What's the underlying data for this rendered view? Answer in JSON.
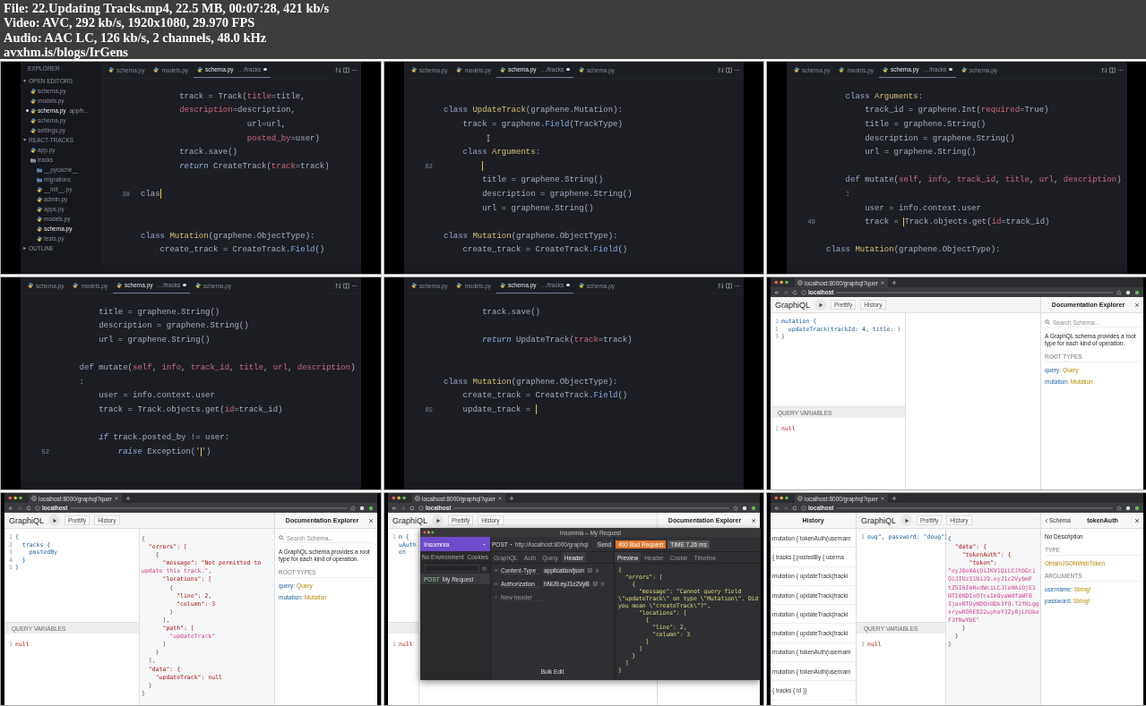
{
  "info": [
    "File: 22.Updating Tracks.mp4, 22.5 MB, 00:07:28, 421 kb/s",
    "Video: AVC, 292 kb/s, 1920x1080, 29.970 FPS",
    "Audio: AAC LC, 126 kb/s, 2 channels, 48.0 kHz",
    "avxhm.is/blogs/IrGens"
  ],
  "frames": [
    {
      "kind": "editor",
      "sidebar": {
        "title": "EXPLORER",
        "sections": [
          {
            "title": "OPEN EDITORS",
            "expanded": true,
            "items": [
              {
                "label": "schema.py",
                "kind": "file",
                "selected": false,
                "modified": false
              },
              {
                "label": "models.py",
                "kind": "file",
                "selected": false,
                "modified": false
              },
              {
                "label": "schema.py",
                "path": "app/tr...",
                "kind": "file",
                "selected": true,
                "modified": true
              },
              {
                "label": "schema.py",
                "kind": "file",
                "selected": false,
                "modified": false
              },
              {
                "label": "settings.py",
                "kind": "file",
                "selected": false,
                "modified": false
              }
            ]
          },
          {
            "title": "REACT-TRACKS",
            "expanded": true,
            "items": [
              {
                "label": "app.py",
                "kind": "file",
                "selected": false,
                "modified": false
              },
              {
                "label": "tracks",
                "kind": "folder",
                "expanded": true,
                "selected": false,
                "modified": false,
                "children": [
                  {
                    "label": "__pycache__",
                    "kind": "folder",
                    "expanded": false,
                    "selected": false,
                    "modified": false
                  },
                  {
                    "label": "migrations",
                    "kind": "folder",
                    "expanded": false,
                    "selected": false,
                    "modified": false
                  },
                  {
                    "label": "__init__.py",
                    "kind": "file",
                    "selected": false,
                    "modified": false
                  },
                  {
                    "label": "admin.py",
                    "kind": "file",
                    "selected": false,
                    "modified": false
                  },
                  {
                    "label": "apps.py",
                    "kind": "file",
                    "selected": false,
                    "modified": false
                  },
                  {
                    "label": "models.py",
                    "kind": "file",
                    "selected": false,
                    "modified": false
                  },
                  {
                    "label": "schema.py",
                    "kind": "file",
                    "selected": true,
                    "modified": false
                  },
                  {
                    "label": "tests.py",
                    "kind": "file",
                    "selected": false,
                    "modified": false
                  }
                ]
              }
            ]
          },
          {
            "title": "OUTLINE",
            "expanded": false
          }
        ]
      },
      "tabs": [
        {
          "label": "schema.py",
          "selected": false,
          "modified": false
        },
        {
          "label": "models.py",
          "selected": false,
          "modified": false
        },
        {
          "label": "schema.py",
          "path": "…/tracks",
          "selected": true,
          "modified": true
        }
      ],
      "lines": [
        {
          "tokens": [
            {
              "text": "        track = Track(",
              "kind": "txt"
            },
            {
              "text": "title",
              "kind": "arg"
            },
            {
              "text": "=title,",
              "kind": "txt"
            }
          ],
          "cursor": false
        },
        {
          "tokens": [
            {
              "text": "        description",
              "kind": "arg"
            },
            {
              "text": "=description,",
              "kind": "txt"
            }
          ],
          "cursor": false
        },
        {
          "tokens": [
            {
              "text": "                      url=url,",
              "kind": "txt"
            }
          ],
          "cursor": false
        },
        {
          "tokens": [
            {
              "text": "                      posted_by",
              "kind": "arg"
            },
            {
              "text": "=user)",
              "kind": "txt"
            }
          ],
          "cursor": false
        },
        {
          "tokens": [
            {
              "text": "        track.save()",
              "kind": "txt"
            }
          ],
          "cursor": false
        },
        {
          "tokens": [
            {
              "text": "        return",
              "kind": "ret"
            },
            {
              "text": " CreateTrack(",
              "kind": "txt"
            },
            {
              "text": "track",
              "kind": "arg"
            },
            {
              "text": "=track)",
              "kind": "txt"
            }
          ],
          "cursor": false
        },
        {
          "cursor": false
        },
        {
          "g": "38",
          "tokens": [
            {
              "text": "clas",
              "kind": "txt"
            }
          ],
          "cursor": true
        },
        {
          "cursor": false
        },
        {
          "cursor": false
        },
        {
          "tokens": [
            {
              "text": "class",
              "kind": "kw"
            },
            {
              "text": " Mutation",
              "kind": "name"
            },
            {
              "text": "(graphene.ObjectType):",
              "kind": "txt"
            }
          ],
          "cursor": false
        },
        {
          "tokens": [
            {
              "text": "    create_track = CreateTrack.",
              "kind": "txt"
            },
            {
              "text": "Field",
              "kind": "fn"
            },
            {
              "text": "()",
              "kind": "txt"
            }
          ],
          "cursor": false
        }
      ]
    },
    {
      "kind": "editor",
      "tabs": [
        {
          "label": "schema.py",
          "selected": false,
          "modified": false
        },
        {
          "label": "models.py",
          "selected": false,
          "modified": false
        },
        {
          "label": "schema.py",
          "path": "…/tracks",
          "selected": true,
          "modified": true
        },
        {
          "label": "schema.py",
          "selected": false,
          "modified": false
        }
      ],
      "lines": [
        {
          "cursor": false
        },
        {
          "tokens": [
            {
              "text": "class",
              "kind": "kw"
            },
            {
              "text": " UpdateTrack",
              "kind": "name"
            },
            {
              "text": "(graphene.Mutation):",
              "kind": "txt"
            }
          ],
          "cursor": false
        },
        {
          "tokens": [
            {
              "text": "    track = graphene.",
              "kind": "txt"
            },
            {
              "text": "Field",
              "kind": "fn"
            },
            {
              "text": "(TrackType)",
              "kind": "txt"
            }
          ],
          "cursor": false
        },
        {
          "pointer": true,
          "cursor": false
        },
        {
          "tokens": [
            {
              "text": "    class",
              "kind": "kw"
            },
            {
              "text": " Arguments",
              "kind": "name"
            },
            {
              "text": ":",
              "kind": "txt"
            }
          ],
          "cursor": false
        },
        {
          "g": "62",
          "cursor": true
        },
        {
          "tokens": [
            {
              "text": "        title = graphene.String()",
              "kind": "txt"
            }
          ],
          "cursor": false
        },
        {
          "tokens": [
            {
              "text": "        description = graphene.String()",
              "kind": "txt"
            }
          ],
          "cursor": false
        },
        {
          "tokens": [
            {
              "text": "        url = graphene.String()",
              "kind": "txt"
            }
          ],
          "cursor": false
        },
        {
          "cursor": false
        },
        {
          "tokens": [
            {
              "text": "class",
              "kind": "kw"
            },
            {
              "text": " Mutation",
              "kind": "name"
            },
            {
              "text": "(graphene.ObjectType):",
              "kind": "txt"
            }
          ],
          "cursor": false
        },
        {
          "tokens": [
            {
              "text": "    create_track = CreateTrack.",
              "kind": "txt"
            },
            {
              "text": "Field",
              "kind": "fn"
            },
            {
              "text": "()",
              "kind": "txt"
            }
          ],
          "cursor": false
        }
      ]
    },
    {
      "kind": "editor",
      "tabs": [
        {
          "label": "schema.py",
          "selected": false,
          "modified": false
        },
        {
          "label": "models.py",
          "selected": false,
          "modified": false
        },
        {
          "label": "schema.py",
          "path": "…/tracks",
          "selected": true,
          "modified": true
        },
        {
          "label": "schema.py",
          "selected": false,
          "modified": false
        }
      ],
      "lines": [
        {
          "tokens": [
            {
              "text": "    class",
              "kind": "kw"
            },
            {
              "text": " Arguments",
              "kind": "name"
            },
            {
              "text": ":",
              "kind": "txt"
            }
          ],
          "cursor": false
        },
        {
          "tokens": [
            {
              "text": "        track_id = graphene.Int(",
              "kind": "txt"
            },
            {
              "text": "required",
              "kind": "arg"
            },
            {
              "text": "=True)",
              "kind": "txt"
            }
          ],
          "cursor": false
        },
        {
          "tokens": [
            {
              "text": "        title = graphene.String()",
              "kind": "txt"
            }
          ],
          "cursor": false
        },
        {
          "tokens": [
            {
              "text": "        description = graphene.String()",
              "kind": "txt"
            }
          ],
          "cursor": false
        },
        {
          "tokens": [
            {
              "text": "        url = graphene.String()",
              "kind": "txt"
            }
          ],
          "cursor": false
        },
        {
          "cursor": false
        },
        {
          "tokens": [
            {
              "text": "    def",
              "kind": "kw"
            },
            {
              "text": " mutate(",
              "kind": "txt"
            },
            {
              "text": "self",
              "kind": "arg"
            },
            {
              "text": ", ",
              "kind": "txt"
            },
            {
              "text": "info",
              "kind": "arg"
            },
            {
              "text": ", ",
              "kind": "txt"
            },
            {
              "text": "track_id",
              "kind": "arg"
            },
            {
              "text": ", ",
              "kind": "txt"
            },
            {
              "text": "title",
              "kind": "arg"
            },
            {
              "text": ", ",
              "kind": "txt"
            },
            {
              "text": "url",
              "kind": "arg"
            },
            {
              "text": ", ",
              "kind": "txt"
            },
            {
              "text": "description",
              "kind": "arg"
            },
            {
              "text": ")",
              "kind": "txt"
            }
          ],
          "cursor": false
        },
        {
          "tokens": [
            {
              "text": "    :",
              "kind": "txt"
            }
          ],
          "cursor": false
        },
        {
          "tokens": [
            {
              "text": "        user = info.context.user",
              "kind": "txt"
            }
          ],
          "cursor": false
        },
        {
          "g": "49",
          "tokens": [
            {
              "text": "        track = ",
              "kind": "txt"
            }
          ],
          "cursor": true,
          "after": [
            {
              "text": "Track.objects.get(",
              "kind": "txt"
            },
            {
              "text": "id",
              "kind": "arg"
            },
            {
              "text": "=track_id)",
              "kind": "txt"
            }
          ]
        },
        {
          "cursor": false
        },
        {
          "tokens": [
            {
              "text": "class",
              "kind": "kw"
            },
            {
              "text": " Mutation",
              "kind": "name"
            },
            {
              "text": "(graphene.ObjectType):",
              "kind": "txt"
            }
          ],
          "cursor": false
        }
      ]
    },
    {
      "kind": "editor",
      "tabs": [
        {
          "label": "schema.py",
          "selected": false,
          "modified": false
        },
        {
          "label": "models.py",
          "selected": false,
          "modified": false
        },
        {
          "label": "schema.py",
          "path": "…/tracks",
          "selected": true,
          "modified": true
        },
        {
          "label": "schema.py",
          "selected": false,
          "modified": false
        }
      ],
      "lines": [
        {
          "tokens": [
            {
              "text": "        title = graphene.String()",
              "kind": "txt"
            }
          ],
          "cursor": false
        },
        {
          "tokens": [
            {
              "text": "        description = graphene.String()",
              "kind": "txt"
            }
          ],
          "cursor": false
        },
        {
          "tokens": [
            {
              "text": "        url = graphene.String()",
              "kind": "txt"
            }
          ],
          "cursor": false
        },
        {
          "cursor": false
        },
        {
          "tokens": [
            {
              "text": "    def",
              "kind": "kw"
            },
            {
              "text": " mutate(",
              "kind": "txt"
            },
            {
              "text": "self",
              "kind": "arg"
            },
            {
              "text": ", ",
              "kind": "txt"
            },
            {
              "text": "info",
              "kind": "arg"
            },
            {
              "text": ", ",
              "kind": "txt"
            },
            {
              "text": "track_id",
              "kind": "arg"
            },
            {
              "text": ", ",
              "kind": "txt"
            },
            {
              "text": "title",
              "kind": "arg"
            },
            {
              "text": ", ",
              "kind": "txt"
            },
            {
              "text": "url",
              "kind": "arg"
            },
            {
              "text": ", ",
              "kind": "txt"
            },
            {
              "text": "description",
              "kind": "arg"
            },
            {
              "text": ")",
              "kind": "txt"
            }
          ],
          "cursor": false
        },
        {
          "tokens": [
            {
              "text": "    :",
              "kind": "txt"
            }
          ],
          "cursor": false
        },
        {
          "tokens": [
            {
              "text": "        user = info.context.user",
              "kind": "txt"
            }
          ],
          "cursor": false
        },
        {
          "tokens": [
            {
              "text": "        track = Track.objects.get(",
              "kind": "txt"
            },
            {
              "text": "id",
              "kind": "arg"
            },
            {
              "text": "=track_id)",
              "kind": "txt"
            }
          ],
          "cursor": false
        },
        {
          "cursor": false
        },
        {
          "tokens": [
            {
              "text": "        if",
              "kind": "ret"
            },
            {
              "text": " track.posted_by != user:",
              "kind": "txt"
            }
          ],
          "cursor": false
        },
        {
          "g": "52",
          "tokens": [
            {
              "text": "            raise",
              "kind": "ret"
            },
            {
              "text": " Exception('",
              "kind": "txt"
            }
          ],
          "cursor": true,
          "after": [
            {
              "text": "')",
              "kind": "txt"
            }
          ]
        }
      ]
    },
    {
      "kind": "editor",
      "tabs": [
        {
          "label": "schema.py",
          "selected": false,
          "modified": false
        },
        {
          "label": "models.py",
          "selected": false,
          "modified": false
        },
        {
          "label": "schema.py",
          "path": "…/tracks",
          "selected": true,
          "modified": true
        },
        {
          "label": "schema.py",
          "selected": false,
          "modified": false
        }
      ],
      "lines": [
        {
          "tokens": [
            {
              "text": "        track.save()",
              "kind": "txt"
            }
          ],
          "cursor": false
        },
        {
          "cursor": false
        },
        {
          "tokens": [
            {
              "text": "        return",
              "kind": "ret"
            },
            {
              "text": " UpdateTrack(",
              "kind": "txt"
            },
            {
              "text": "track",
              "kind": "arg"
            },
            {
              "text": "=track)",
              "kind": "txt"
            }
          ],
          "cursor": false
        },
        {
          "cursor": false
        },
        {
          "cursor": false
        },
        {
          "tokens": [
            {
              "text": "class",
              "kind": "kw"
            },
            {
              "text": " Mutation",
              "kind": "name"
            },
            {
              "text": "(graphene.ObjectType):",
              "kind": "txt"
            }
          ],
          "cursor": false
        },
        {
          "tokens": [
            {
              "text": "    create_track = CreateTrack.",
              "kind": "txt"
            },
            {
              "text": "Field",
              "kind": "fn"
            },
            {
              "text": "()",
              "kind": "txt"
            }
          ],
          "cursor": false
        },
        {
          "g": "65",
          "tokens": [
            {
              "text": "    update_track = ",
              "kind": "txt"
            }
          ],
          "cursor": true
        }
      ]
    },
    {
      "kind": "graphiql",
      "browser": {
        "tab": "localhost:8000/graphql?quer",
        "url": "localhost"
      },
      "toolbar": {
        "title": "GraphiQL",
        "buttons": [
          "Prettify",
          "History"
        ]
      },
      "query": [
        {
          "n": "1",
          "text": "mutation {"
        },
        {
          "n": "2",
          "text": "  updateTrack(trackId: 4, title: )"
        },
        {
          "n": "3",
          "text": "}"
        }
      ],
      "variables_title": "QUERY VARIABLES",
      "variables": [
        {
          "n": "1",
          "text": "null"
        }
      ],
      "docs": {
        "title": "Documentation Explorer",
        "search": {
          "placeholder": "Search Schema..."
        },
        "description": "A GraphQL schema provides a root type for each kind of operation.",
        "sections": [
          {
            "heading": "ROOT TYPES",
            "items": [
              {
                "name": "query:",
                "type": "Query"
              },
              {
                "name": "mutation:",
                "type": "Mutation"
              }
            ]
          }
        ]
      }
    },
    {
      "kind": "graphiql",
      "browser": {
        "tab": "localhost:8000/graphql?quer",
        "url": "localhost"
      },
      "toolbar": {
        "title": "GraphiQL",
        "buttons": [
          "Prettify",
          "History"
        ]
      },
      "query": [
        {
          "n": "1",
          "text": "{"
        },
        {
          "n": "2",
          "text": "  tracks {"
        },
        {
          "n": "3",
          "text": "    postedBy"
        },
        {
          "n": "4",
          "text": "  }"
        },
        {
          "n": "5",
          "text": "}"
        }
      ],
      "result": [
        {
          "text": "{",
          "kind": "p"
        },
        {
          "text": "  \"errors\": [",
          "kind": "key"
        },
        {
          "text": "    {",
          "kind": "p"
        },
        {
          "text": "      \"message\": \"Not permitted to",
          "kind": "key"
        },
        {
          "text": "update this track.\",",
          "kind": "str"
        },
        {
          "text": "      \"locations\": [",
          "kind": "key"
        },
        {
          "text": "        {",
          "kind": "p"
        },
        {
          "text": "          \"line\": 2,",
          "kind": "key"
        },
        {
          "text": "          \"column\": 3",
          "kind": "key"
        },
        {
          "text": "        }",
          "kind": "p"
        },
        {
          "text": "      ],",
          "kind": "p"
        },
        {
          "text": "      \"path\": [",
          "kind": "key"
        },
        {
          "text": "        \"updateTrack\"",
          "kind": "str"
        },
        {
          "text": "      ]",
          "kind": "p"
        },
        {
          "text": "    }",
          "kind": "p"
        },
        {
          "text": "  ],",
          "kind": "p"
        },
        {
          "text": "  \"data\": {",
          "kind": "key"
        },
        {
          "text": "    \"updateTrack\": null",
          "kind": "key"
        },
        {
          "text": "  }",
          "kind": "p"
        },
        {
          "text": "}",
          "kind": "p"
        }
      ],
      "variables_title": "QUERY VARIABLES",
      "variables": [
        {
          "n": "1",
          "text": "null"
        }
      ],
      "docs": {
        "title": "Documentation Explorer",
        "search": {
          "placeholder": "Search Schema..."
        },
        "description": "A GraphQL schema provides a root type for each kind of operation.",
        "sections": [
          {
            "heading": "ROOT TYPES",
            "items": [
              {
                "name": "query:",
                "type": "Query"
              },
              {
                "name": "mutation:",
                "type": "Mutation"
              }
            ]
          }
        ]
      }
    },
    {
      "kind": "graphiql",
      "browser": {
        "tab": "localhost:8000/graphql?quer",
        "url": "localhost"
      },
      "toolbar": {
        "title": "GraphiQL",
        "buttons": [
          "Prettify",
          "History"
        ]
      },
      "query": [
        {
          "n": "1",
          "text": "m {"
        },
        {
          "text": "uAuth"
        },
        {
          "text": "en"
        }
      ],
      "variables": [
        {
          "n": "1",
          "text": "null"
        }
      ],
      "docs": {
        "title": "Documentation Explorer"
      },
      "overlay": {
        "title": "Insomnia – My Request",
        "brand": "Insomnia",
        "environment": "No Environment",
        "cookies": "Cookies",
        "requests": [
          {
            "method": "POST",
            "name": "My Request",
            "selected": true
          }
        ],
        "method": "POST",
        "url": "http://localhost:8000/graphql",
        "send": "Send",
        "status": "400 Bad Request",
        "time": "TIME 7.26 ms",
        "request_tabs": [
          {
            "label": "GraphQL",
            "selected": false
          },
          {
            "label": "Auth",
            "selected": false
          },
          {
            "label": "Query",
            "selected": false
          },
          {
            "label": "Header",
            "selected": true
          }
        ],
        "headers": [
          {
            "name": "Content-Type",
            "value": "application/json",
            "enabled": true
          },
          {
            "name": "Authorization",
            "value": "hNiJ9.eyJ1c2VyB",
            "enabled": true
          }
        ],
        "new_header": {
          "placeholder": "New header"
        },
        "bulk_edit": "Bulk Edit",
        "response_tabs": [
          {
            "label": "Preview",
            "selected": true
          },
          {
            "label": "Header",
            "selected": false
          },
          {
            "label": "Cookie",
            "selected": false
          },
          {
            "label": "Timeline",
            "selected": false
          }
        ],
        "response": [
          "{",
          "  \"errors\": [",
          "    {",
          "      \"message\": \"Cannot query field",
          "\\\"updateTrack\\\" on type \\\"Mutation\\\". Did",
          "you mean \\\"createTrack\\\"?\",",
          "      \"locations\": [",
          "        {",
          "          \"line\": 2,",
          "          \"column\": 3",
          "        }",
          "      ]",
          "    }",
          "  ]",
          "}"
        ]
      }
    },
    {
      "kind": "graphiql",
      "browser": {
        "tab": "localhost:8000/graphql?quer",
        "url": "localhost"
      },
      "history": {
        "title": "History",
        "items": [
          "mutation { tokenAuth(usernam",
          "{ tracks { postedBy { userna",
          "mutation { updateTrack(tracki",
          "mutation { updateTrack(tracki",
          "mutation { updateTrack(tracki",
          "mutation { updateTrack(tracki",
          "mutation { tokenAuth(usernam",
          "mutation { tokenAuth(usernam",
          "{ tracks { id }}"
        ]
      },
      "toolbar": {
        "title": "GraphiQL",
        "buttons": [
          "Prettify",
          "History"
        ]
      },
      "query": [
        {
          "n": "1",
          "text": "oug\", password: \"doug\"}"
        }
      ],
      "result": [
        {
          "text": "{",
          "kind": "p"
        },
        {
          "text": "  \"data\": {",
          "kind": "key"
        },
        {
          "text": "    \"tokenAuth\": {",
          "kind": "key"
        },
        {
          "text": "      \"token\":",
          "kind": "key"
        },
        {
          "text": "\"eyJ0eXAiOiJKV1QiLCJhbGci",
          "kind": "str"
        },
        {
          "text": "OiJIUzI1NiJ9.eyJ1c2VybmF",
          "kind": "str"
        },
        {
          "text": "tZSI6ImRvdWciLCJleHAiOjE1",
          "kind": "str"
        },
        {
          "text": "NTI0NDIxOTcsIm9yaWdfaWF0",
          "kind": "str"
        },
        {
          "text": "IjoxNTUyNDQxODk3fQ.T2fKLgg",
          "kind": "str"
        },
        {
          "text": "xrywRORE822uyhoY3Zy8jLhUke",
          "kind": "str"
        },
        {
          "text": "F3fNwYbE\"",
          "kind": "str"
        },
        {
          "text": "    }",
          "kind": "p"
        },
        {
          "text": "  }",
          "kind": "p"
        },
        {
          "text": "}",
          "kind": "p"
        }
      ],
      "variables_title": "QUERY VARIABLES",
      "variables": [
        {
          "n": "1",
          "text": "null"
        }
      ],
      "docs": {
        "back": "Schema",
        "title": "tokenAuth",
        "description": "No Description",
        "sections": [
          {
            "heading": "TYPE",
            "items": [
              {
                "type": "ObtainJSONWebToken"
              }
            ]
          },
          {
            "heading": "ARGUMENTS",
            "items": [
              {
                "name": "username:",
                "type": "String!"
              },
              {
                "name": "password:",
                "type": "String!"
              }
            ]
          }
        ]
      }
    }
  ]
}
